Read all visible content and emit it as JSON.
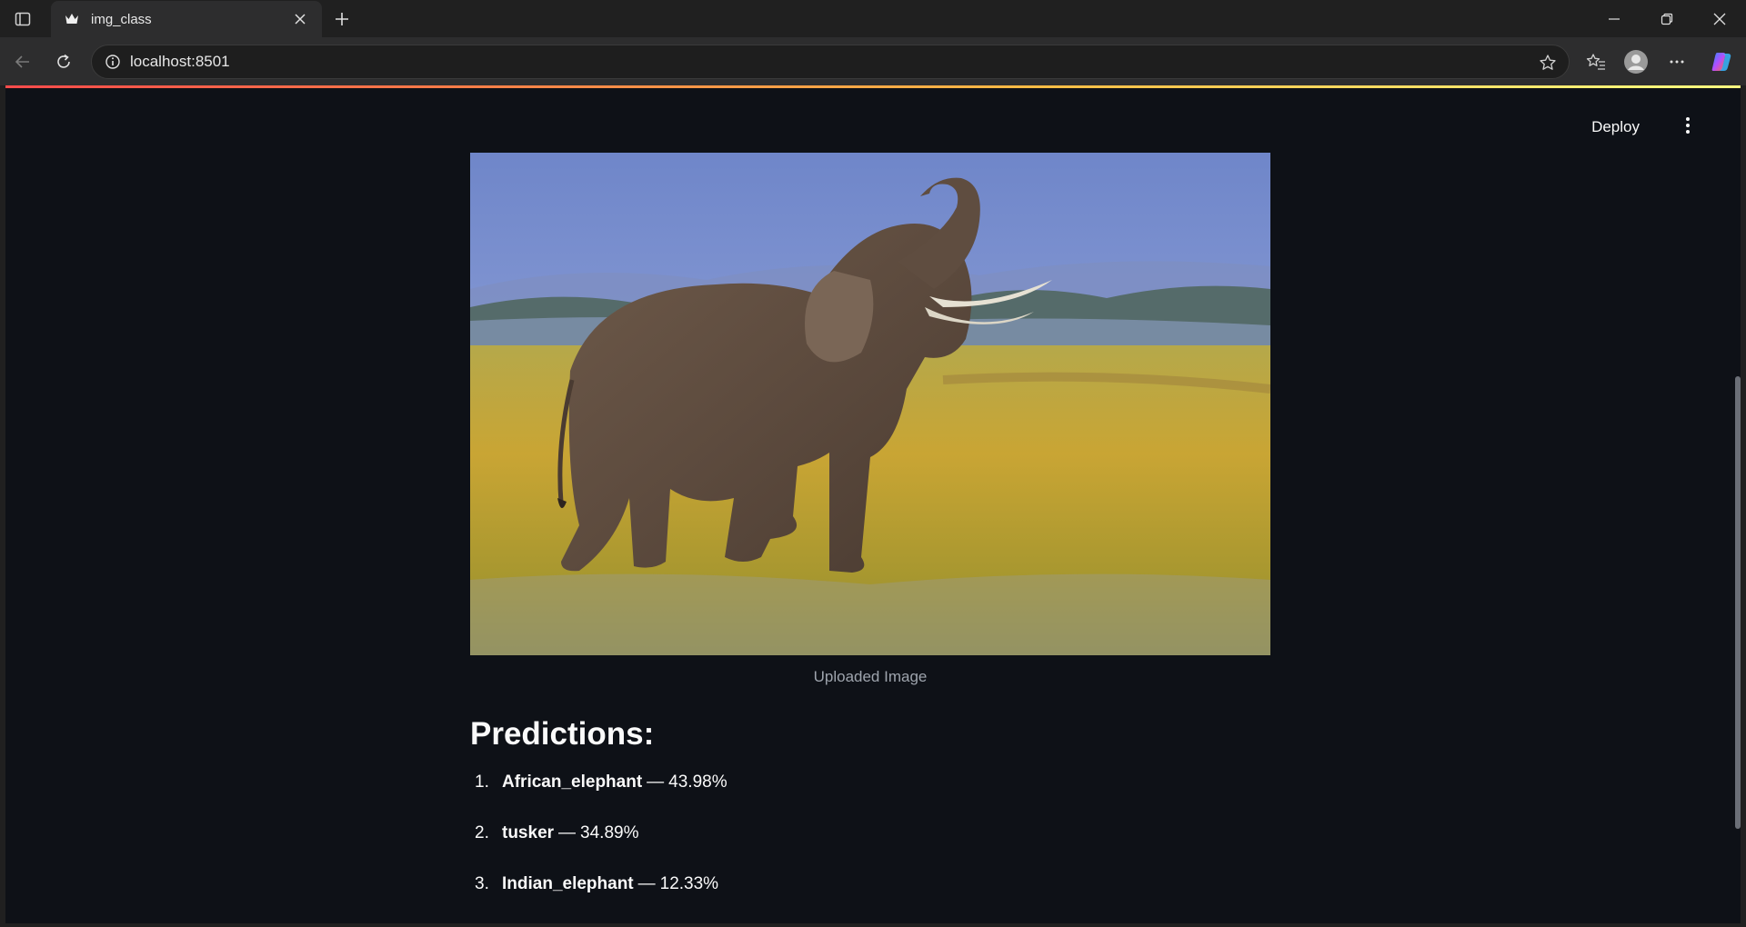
{
  "browser": {
    "tab_title": "img_class",
    "url": "localhost:8501"
  },
  "app": {
    "deploy_label": "Deploy",
    "image_caption": "Uploaded Image",
    "predictions_heading": "Predictions:",
    "predictions": [
      {
        "rank": "1.",
        "label": "African_elephant",
        "separator": "—",
        "confidence": "43.98%"
      },
      {
        "rank": "2.",
        "label": "tusker",
        "separator": "—",
        "confidence": "34.89%"
      },
      {
        "rank": "3.",
        "label": "Indian_elephant",
        "separator": "—",
        "confidence": "12.33%"
      }
    ]
  },
  "colors": {
    "page_background": "#0e1117",
    "accent": "#ff4b4b",
    "text": "#fafafa"
  },
  "icons": [
    "tab-actions-icon",
    "crown-favicon-icon",
    "close-icon",
    "plus-icon",
    "minimize-icon",
    "restore-icon",
    "back-arrow-icon",
    "reload-icon",
    "info-icon",
    "star-icon",
    "favorites-icon",
    "profile-icon",
    "more-icon",
    "copilot-icon",
    "kebab-menu-icon"
  ]
}
